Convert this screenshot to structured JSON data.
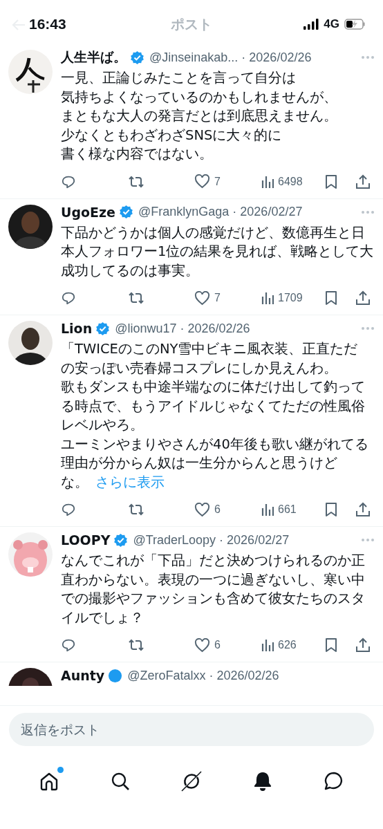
{
  "status_bar": {
    "time": "16:43",
    "network": "4G"
  },
  "header": {
    "title": "ポスト"
  },
  "replies": [
    {
      "name": "人生半ば。",
      "handle": "@Jinseinakab...",
      "date": "· 2026/02/26",
      "lines": [
        "一見、正論じみたことを言って自分は",
        "気持ちよくなっているのかもしれませんが、",
        "まともな大人の発言だとは到底思えません。",
        "少なくともわざわざSNSに大々的に",
        "書く様な内容ではない。"
      ],
      "likes": "7",
      "views": "6498"
    },
    {
      "name": "UgoEze",
      "handle": "@FranklynGaga",
      "date": "· 2026/02/27",
      "lines": [
        "下品かどうかは個人の感覚だけど、数億再生と日",
        "本人フォロワー1位の結果を見れば、戦略として大",
        "成功してるのは事実。"
      ],
      "likes": "7",
      "views": "1709"
    },
    {
      "name": "Lion",
      "handle": "@lionwu17",
      "date": "· 2026/02/26",
      "lines": [
        "「TWICEのこのNY雪中ビキニ風衣装、正直ただ",
        "の安っぽい売春婦コスプレにしか見えんわ。",
        "歌もダンスも中途半端なのに体だけ出して釣って",
        "る時点で、もうアイドルじゃなくてただの性風俗",
        "レベルやろ。",
        "ユーミンやまりやさんが40年後も歌い継がれてる",
        "理由が分からん奴は一生分からんと思うけど",
        "な。"
      ],
      "show_more": "さらに表示",
      "likes": "6",
      "views": "661"
    },
    {
      "name": "LOOPY",
      "handle": "@TraderLoopy",
      "date": "· 2026/02/27",
      "lines": [
        "なんでこれが「下品」だと決めつけられるのか正",
        "直わからない。表現の一つに過ぎないし、寒い中",
        "での撮影やファッションも含めて彼女たちのスタ",
        "イルでしょ？"
      ],
      "likes": "6",
      "views": "626"
    }
  ],
  "partial_reply": {
    "name": "Aunty",
    "handle": "@ZeroFatalxx",
    "date": "· 2026/02/26"
  },
  "reply_box": {
    "placeholder": "返信をポスト"
  },
  "nav": [
    {
      "kind": "home",
      "dot": true
    },
    {
      "kind": "search",
      "dot": false
    },
    {
      "kind": "grok",
      "dot": false
    },
    {
      "kind": "bell",
      "dot": false
    },
    {
      "kind": "chat",
      "dot": false
    }
  ]
}
